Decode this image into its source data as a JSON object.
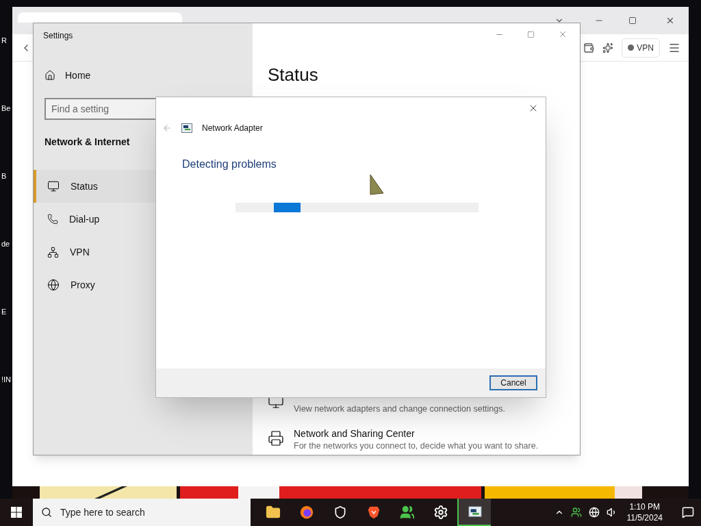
{
  "desktop_icons": [
    {
      "label": "R"
    },
    {
      "label": "Be"
    },
    {
      "label": "B"
    },
    {
      "label": "de"
    },
    {
      "label": "E"
    },
    {
      "label": "!IN"
    }
  ],
  "browser": {
    "vpn_label": "VPN"
  },
  "settings": {
    "title": "Settings",
    "home": "Home",
    "search": {
      "placeholder": "Find a setting"
    },
    "section": "Network & Internet",
    "nav": [
      {
        "label": "Status",
        "kind": "status",
        "selected": true
      },
      {
        "label": "Dial-up",
        "kind": "dialup",
        "selected": false
      },
      {
        "label": "VPN",
        "kind": "vpn",
        "selected": false
      },
      {
        "label": "Proxy",
        "kind": "proxy",
        "selected": false
      }
    ],
    "heading": "Status",
    "links": [
      {
        "description": "View network adapters and change connection settings.",
        "kind": "adapter"
      },
      {
        "title": "Network and Sharing Center",
        "description": "For the networks you connect to, decide what you want to share.",
        "kind": "sharing"
      }
    ]
  },
  "dialog": {
    "title": "Network Adapter",
    "heading": "Detecting problems",
    "button": "Cancel"
  },
  "taskbar": {
    "search_placeholder": "Type here to search",
    "apps": [
      {
        "kind": "folder",
        "active": false
      },
      {
        "kind": "firefox",
        "active": false
      },
      {
        "kind": "shield",
        "active": false
      },
      {
        "kind": "brave",
        "active": false
      },
      {
        "kind": "people",
        "active": false
      },
      {
        "kind": "gear",
        "active": false
      },
      {
        "kind": "troubleshooter",
        "active": true
      }
    ],
    "time": "1:10 PM",
    "date": "11/5/2024"
  }
}
